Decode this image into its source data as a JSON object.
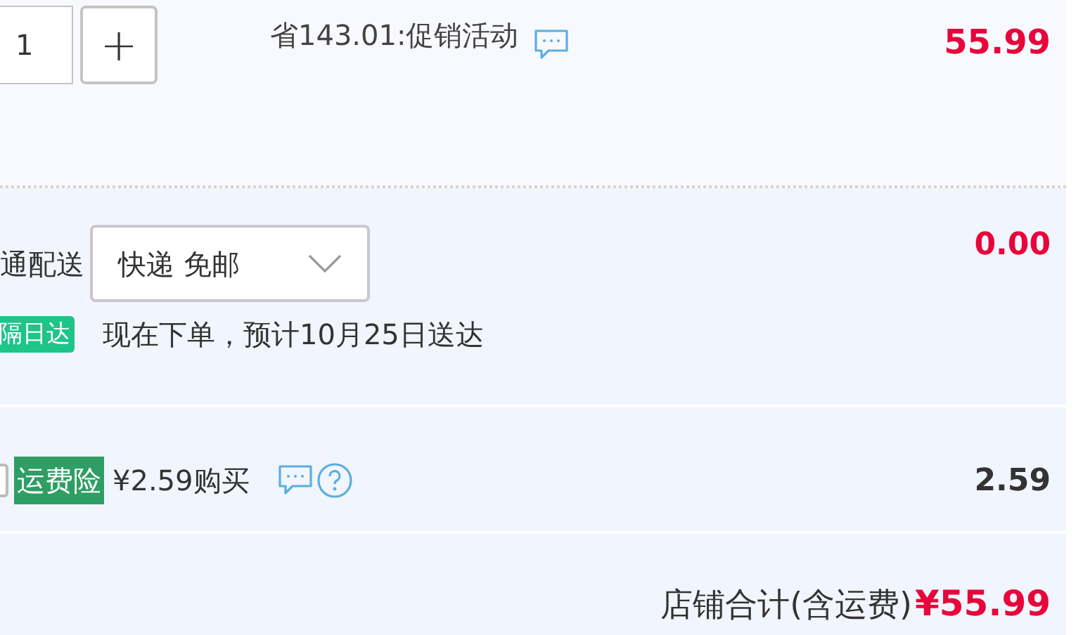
{
  "item": {
    "quantity": "1",
    "plus": "+",
    "promo": "省143.01:促销活动",
    "price": "55.99"
  },
  "delivery": {
    "label": "通配送",
    "select_value": "快递 免邮",
    "fee": "0.00",
    "badge": "隔日达",
    "estimate": "现在下单，预计10月25日送达"
  },
  "insurance": {
    "checked": false,
    "tag": "运费险",
    "offer": "¥2.59购买",
    "amount": "2.59"
  },
  "total": {
    "label": "店铺合计(含运费)",
    "amount": "¥55.99"
  }
}
